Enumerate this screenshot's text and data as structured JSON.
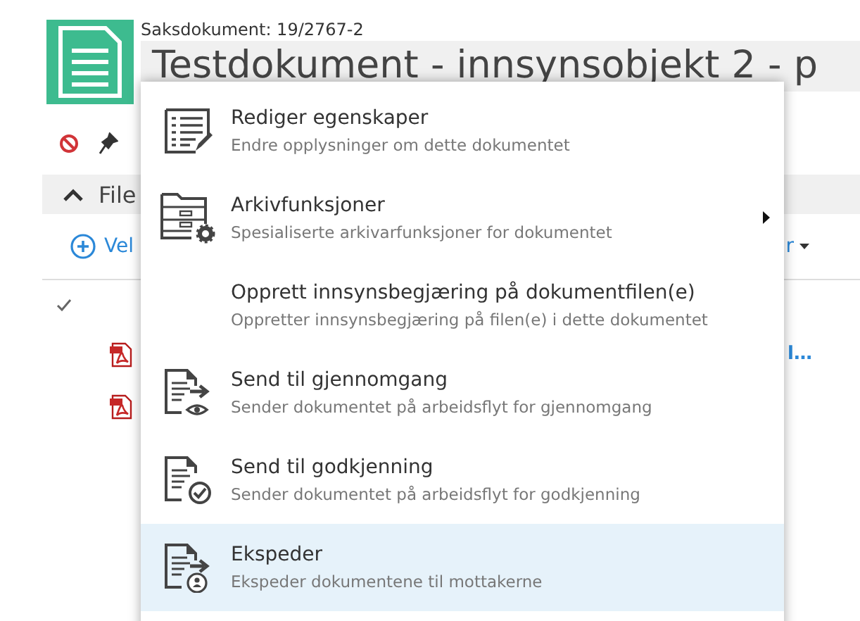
{
  "document": {
    "type_label": "Saksdokument: 19/2767-2",
    "title": "Testdokument - innsynsobjekt 2 - p"
  },
  "section": {
    "label": "File",
    "expanded": true
  },
  "actions": {
    "add_label": "Vel",
    "menu_label": "r"
  },
  "files": [
    {
      "kind": "pdf",
      "name": "l…"
    },
    {
      "kind": "pdf"
    }
  ],
  "menu": [
    {
      "kind": "edit",
      "title": "Rediger egenskaper",
      "description": "Endre opplysninger om dette dokumentet",
      "submenu": false,
      "selected": false
    },
    {
      "kind": "archive",
      "title": "Arkivfunksjoner",
      "description": "Spesialiserte arkivarfunksjoner for dokumentet",
      "submenu": true,
      "selected": false
    },
    {
      "kind": "plain",
      "title": "Opprett innsynsbegjæring på dokumentfilen(e)",
      "description": "Oppretter innsynsbegjæring på filen(e) i dette dokumentet",
      "submenu": false,
      "selected": false
    },
    {
      "kind": "review",
      "title": "Send til gjennomgang",
      "description": "Sender dokumentet på arbeidsflyt for gjennomgang",
      "submenu": false,
      "selected": false
    },
    {
      "kind": "approve",
      "title": "Send til godkjenning",
      "description": "Sender dokumentet på arbeidsflyt for godkjenning",
      "submenu": false,
      "selected": false
    },
    {
      "kind": "dispatch",
      "title": "Ekspeder",
      "description": "Ekspeder dokumentene til mottakerne",
      "submenu": false,
      "selected": true
    }
  ]
}
